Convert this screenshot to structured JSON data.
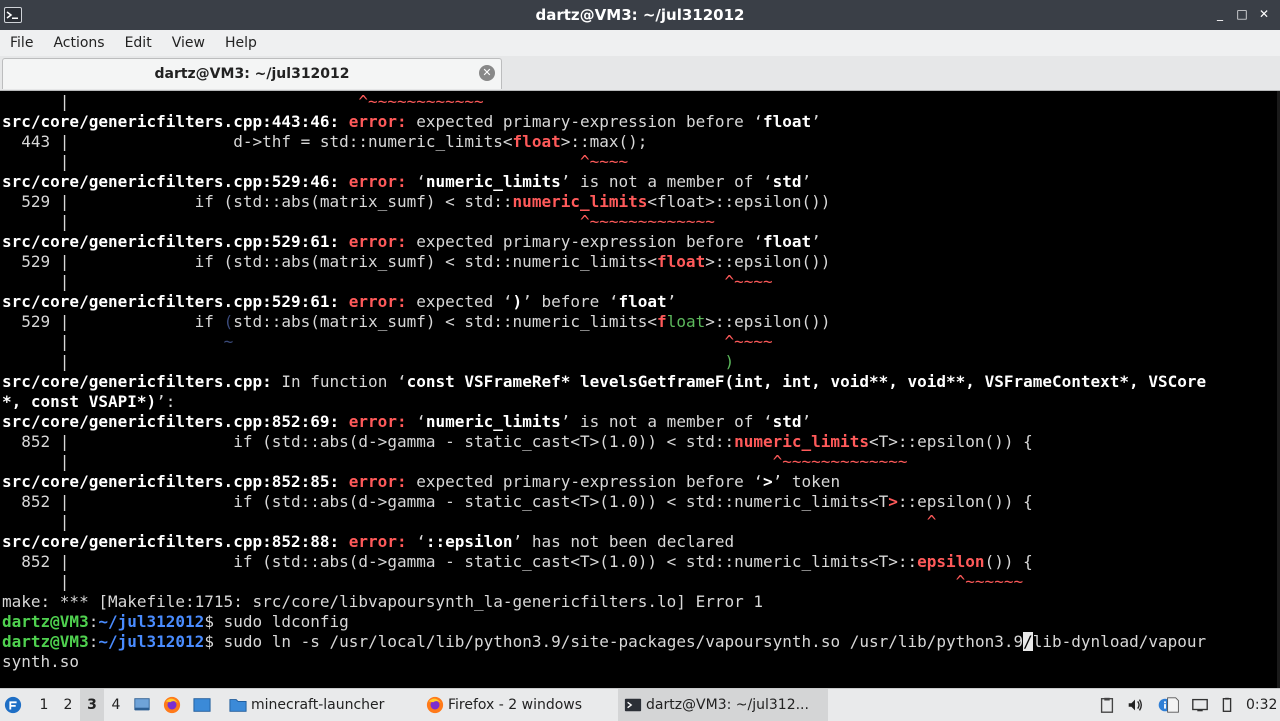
{
  "window": {
    "title": "dartz@VM3: ~/jul312012",
    "controls": {
      "minimize": "_",
      "maximize": "□",
      "close": "✕"
    }
  },
  "menu": [
    "File",
    "Actions",
    "Edit",
    "View",
    "Help"
  ],
  "tab": {
    "label": "dartz@VM3: ~/jul312012",
    "close_glyph": "✕"
  },
  "terminal": {
    "colors": {
      "background": "#000000",
      "text": "#d8d8d8",
      "error": "#ff5a5a",
      "prompt_user": "#4fd14f",
      "prompt_path": "#4a8cff"
    },
    "lines": [
      [
        [
          "      |                              ",
          ""
        ],
        [
          "^~~~~~~~~~~~~",
          "ul"
        ]
      ],
      [
        [
          "src/core/genericfilters.cpp:443:46: ",
          "b"
        ],
        [
          "error: ",
          "err"
        ],
        [
          "expected primary-expression before ‘",
          ""
        ],
        [
          "float",
          "b"
        ],
        [
          "’",
          ""
        ]
      ],
      [
        [
          "  443 |                 d->thf = std::numeric_limits<",
          ""
        ],
        [
          "float",
          "hl"
        ],
        [
          ">::max();",
          ""
        ]
      ],
      [
        [
          "      |                                                     ",
          ""
        ],
        [
          "^~~~~",
          "ul"
        ]
      ],
      [
        [
          "src/core/genericfilters.cpp:529:46: ",
          "b"
        ],
        [
          "error: ",
          "err"
        ],
        [
          "‘",
          ""
        ],
        [
          "numeric_limits",
          "b"
        ],
        [
          "’ is not a member of ‘",
          ""
        ],
        [
          "std",
          "b"
        ],
        [
          "’",
          ""
        ]
      ],
      [
        [
          "  529 |             if (std::abs(matrix_sumf) < std::",
          ""
        ],
        [
          "numeric_limits",
          "hl"
        ],
        [
          "<float>::epsilon())",
          ""
        ]
      ],
      [
        [
          "      |                                                     ",
          ""
        ],
        [
          "^~~~~~~~~~~~~~",
          "ul"
        ]
      ],
      [
        [
          "src/core/genericfilters.cpp:529:61: ",
          "b"
        ],
        [
          "error: ",
          "err"
        ],
        [
          "expected primary-expression before ‘",
          ""
        ],
        [
          "float",
          "b"
        ],
        [
          "’",
          ""
        ]
      ],
      [
        [
          "  529 |             if (std::abs(matrix_sumf) < std::numeric_limits<",
          ""
        ],
        [
          "float",
          "hl"
        ],
        [
          ">::epsilon())",
          ""
        ]
      ],
      [
        [
          "      |                                                                    ",
          ""
        ],
        [
          "^~~~~",
          "ul"
        ]
      ],
      [
        [
          "src/core/genericfilters.cpp:529:61: ",
          "b"
        ],
        [
          "error: ",
          "err"
        ],
        [
          "expected ‘",
          ""
        ],
        [
          ")",
          "b"
        ],
        [
          "’ before ‘",
          ""
        ],
        [
          "float",
          "b"
        ],
        [
          "’",
          ""
        ]
      ],
      [
        [
          "  529 |             if ",
          ""
        ],
        [
          "(",
          "dimblue"
        ],
        [
          "std::abs(matrix_sumf) < std::numeric_limits<",
          ""
        ],
        [
          "f",
          "hl"
        ],
        [
          "loat",
          "grn"
        ],
        [
          ">::epsilon())",
          ""
        ]
      ],
      [
        [
          "      |                ",
          ""
        ],
        [
          "~",
          "dimblue"
        ],
        [
          "                                                   ",
          ""
        ],
        [
          "^~~~~",
          "ul"
        ]
      ],
      [
        [
          "      |                                                                    ",
          ""
        ],
        [
          ")",
          "grn"
        ]
      ],
      [
        [
          "src/core/genericfilters.cpp: ",
          "b"
        ],
        [
          "In function ‘",
          ""
        ],
        [
          "const VSFrameRef* levelsGetframeF(int, int, void**, void**, VSFrameContext*, VSCore",
          "b"
        ]
      ],
      [
        [
          "*, const VSAPI*)",
          "b"
        ],
        [
          "’:",
          ""
        ]
      ],
      [
        [
          "src/core/genericfilters.cpp:852:69: ",
          "b"
        ],
        [
          "error: ",
          "err"
        ],
        [
          "‘",
          ""
        ],
        [
          "numeric_limits",
          "b"
        ],
        [
          "’ is not a member of ‘",
          ""
        ],
        [
          "std",
          "b"
        ],
        [
          "’",
          ""
        ]
      ],
      [
        [
          "  852 |                 if (std::abs(d->gamma - static_cast<T>(1.0)) < std::",
          ""
        ],
        [
          "numeric_limits",
          "hl"
        ],
        [
          "<T>::epsilon()) {",
          ""
        ]
      ],
      [
        [
          "      |                                                                         ",
          ""
        ],
        [
          "^~~~~~~~~~~~~~",
          "ul"
        ]
      ],
      [
        [
          "src/core/genericfilters.cpp:852:85: ",
          "b"
        ],
        [
          "error: ",
          "err"
        ],
        [
          "expected primary-expression before ‘",
          ""
        ],
        [
          ">",
          "b"
        ],
        [
          "’ token",
          ""
        ]
      ],
      [
        [
          "  852 |                 if (std::abs(d->gamma - static_cast<T>(1.0)) < std::numeric_limits<T",
          ""
        ],
        [
          ">",
          "hl"
        ],
        [
          "::epsilon()) {",
          ""
        ]
      ],
      [
        [
          "      |                                                                                         ",
          ""
        ],
        [
          "^",
          "ul"
        ]
      ],
      [
        [
          "src/core/genericfilters.cpp:852:88: ",
          "b"
        ],
        [
          "error: ",
          "err"
        ],
        [
          "‘",
          ""
        ],
        [
          "::epsilon",
          "b"
        ],
        [
          "’ has not been declared",
          ""
        ]
      ],
      [
        [
          "  852 |                 if (std::abs(d->gamma - static_cast<T>(1.0)) < std::numeric_limits<T>::",
          ""
        ],
        [
          "epsilon",
          "hl"
        ],
        [
          "()) {",
          ""
        ]
      ],
      [
        [
          "      |                                                                                            ",
          ""
        ],
        [
          "^~~~~~~",
          "ul"
        ]
      ],
      [
        [
          "make: *** [Makefile:1715: src/core/libvapoursynth_la-genericfilters.lo] Error 1",
          ""
        ]
      ],
      [
        [
          "dartz@VM3",
          "pu"
        ],
        [
          ":",
          ""
        ],
        [
          "~/jul312012",
          "pp"
        ],
        [
          "$ sudo ldconfig",
          ""
        ]
      ],
      [
        [
          "dartz@VM3",
          "pu"
        ],
        [
          ":",
          ""
        ],
        [
          "~/jul312012",
          "pp"
        ],
        [
          "$ sudo ln -s /usr/local/lib/python3.9/site-packages/vapoursynth.so /usr/lib/python3.9",
          ""
        ],
        [
          "/",
          "cur"
        ],
        [
          "lib-dynload/vapour",
          ""
        ]
      ],
      [
        [
          "synth.so",
          ""
        ]
      ]
    ]
  },
  "taskbar": {
    "workspaces": [
      "1",
      "2",
      "3",
      "4"
    ],
    "active_workspace": "3",
    "buttons": [
      {
        "label": "minecraft-launcher",
        "icon": "folder-icon"
      },
      {
        "label": "Firefox - 2 windows",
        "icon": "firefox-icon"
      },
      {
        "label": "dartz@VM3: ~/jul312...",
        "icon": "terminal-icon"
      }
    ],
    "clock": "0:32"
  }
}
